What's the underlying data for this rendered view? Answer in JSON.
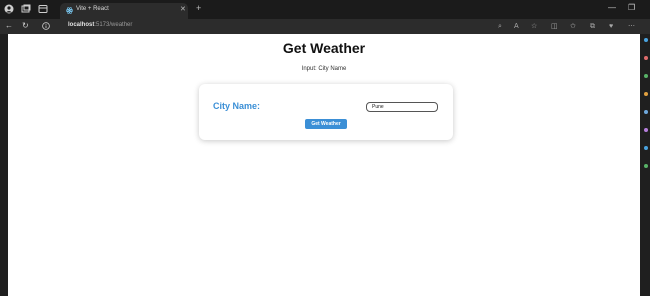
{
  "browser": {
    "tab": {
      "title": "Vite + React",
      "favicon": "react-icon"
    },
    "address": {
      "host": "localhost",
      "path": ":5173/weather"
    }
  },
  "page": {
    "title": "Get Weather",
    "subtitle": "Input: City Name"
  },
  "form": {
    "city_label": "City Name:",
    "city_value": "Pune",
    "button_label": "Get Weather"
  },
  "colors": {
    "accent": "#3b8fd6",
    "rail_dots": [
      "#4aa3df",
      "#e06c6c",
      "#58b368",
      "#e0a040",
      "#6fa8dc",
      "#b57edc",
      "#4aa3df",
      "#58b368"
    ]
  }
}
